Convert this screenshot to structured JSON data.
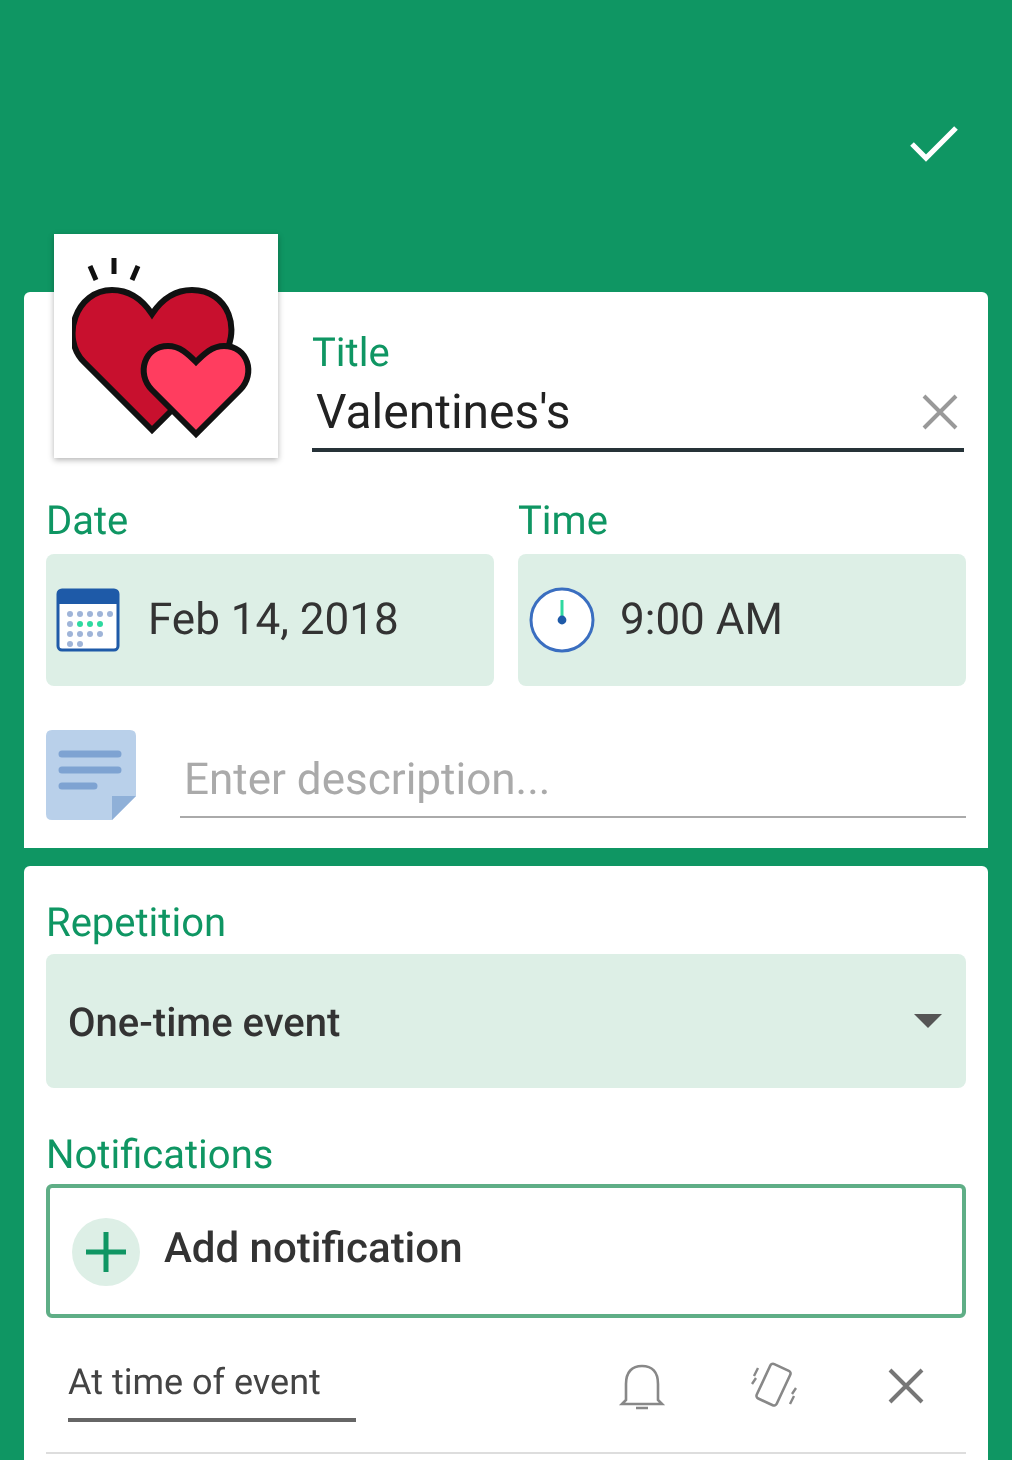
{
  "title_field": {
    "label": "Title",
    "value": "Valentines's"
  },
  "date": {
    "label": "Date",
    "value": "Feb 14, 2018"
  },
  "time": {
    "label": "Time",
    "value": "9:00 AM"
  },
  "description": {
    "placeholder": "Enter description..."
  },
  "repetition": {
    "label": "Repetition",
    "value": "One-time event"
  },
  "notifications": {
    "label": "Notifications",
    "add_button": "Add notification",
    "items": [
      {
        "text": "At time of event"
      }
    ]
  }
}
